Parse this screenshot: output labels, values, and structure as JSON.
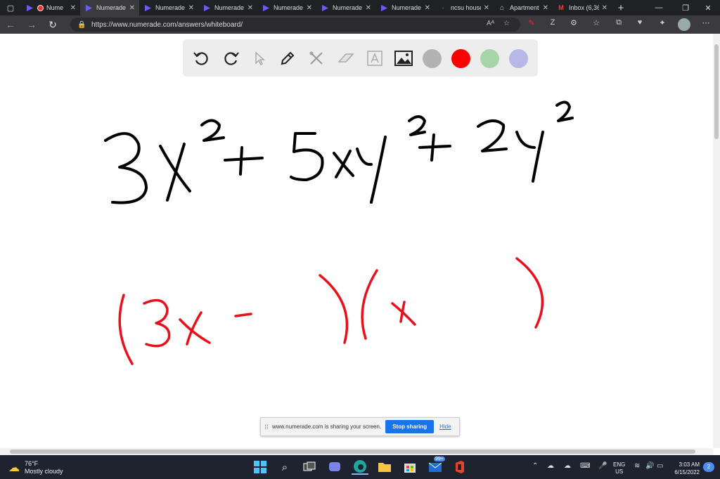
{
  "tabs": [
    {
      "label": "Nume",
      "favicon": "numerade-icon",
      "active": false
    },
    {
      "label": "Numerade",
      "favicon": "numerade-icon",
      "active": true
    },
    {
      "label": "Numerade",
      "favicon": "numerade-icon",
      "active": false
    },
    {
      "label": "Numerade",
      "favicon": "numerade-icon",
      "active": false
    },
    {
      "label": "Numerade",
      "favicon": "numerade-icon",
      "active": false
    },
    {
      "label": "Numerade",
      "favicon": "numerade-icon",
      "active": false
    },
    {
      "label": "Numerade",
      "favicon": "numerade-icon",
      "active": false
    },
    {
      "label": "ncsu house",
      "favicon": "ncsu-icon",
      "active": false
    },
    {
      "label": "Apartment",
      "favicon": "home-icon",
      "active": false
    },
    {
      "label": "Inbox (6,36",
      "favicon": "gmail-icon",
      "active": false
    }
  ],
  "address": {
    "url": "https://www.numerade.com/answers/whiteboard/"
  },
  "toolbar": {
    "tools": [
      "undo-icon",
      "redo-icon",
      "pointer-icon",
      "pen-icon",
      "tools-icon",
      "eraser-icon",
      "text-icon",
      "image-icon"
    ],
    "colors": [
      "#b3b3b3",
      "#ff0000",
      "#a8d5a8",
      "#b7b7e8"
    ]
  },
  "whiteboard": {
    "line1": "3x² + 5xy² + 2y²",
    "line2": "(3x -   )(x   )",
    "ink_black": "#000000",
    "ink_red": "#e8101a"
  },
  "share_bar": {
    "message": "www.numerade.com is sharing your screen.",
    "stop_label": "Stop sharing",
    "hide_label": "Hide"
  },
  "taskbar": {
    "weather_temp": "76°F",
    "weather_desc": "Mostly cloudy",
    "lang_top": "ENG",
    "lang_bottom": "US",
    "time": "3:03 AM",
    "date": "6/15/2022",
    "notification_count": "2",
    "badge_count": "99+"
  }
}
